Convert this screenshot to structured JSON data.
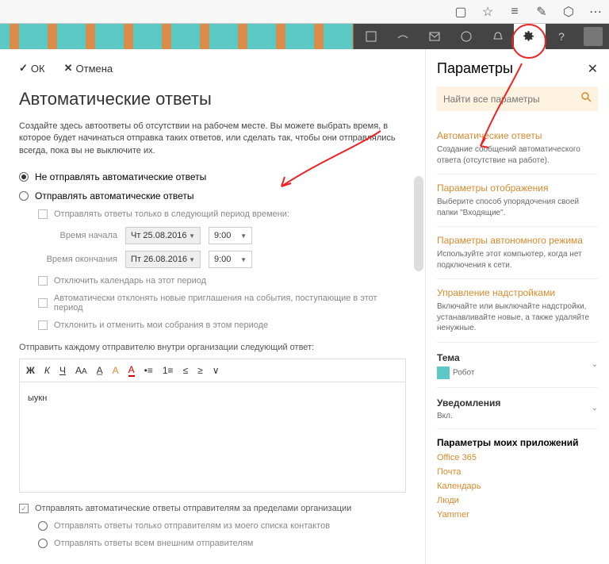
{
  "browser": {
    "icons": [
      "book",
      "star",
      "lines",
      "pen",
      "share",
      "more"
    ]
  },
  "actions": {
    "ok": "ОК",
    "cancel": "Отмена"
  },
  "main": {
    "title": "Автоматические ответы",
    "description": "Создайте здесь автоответы об отсутствии на рабочем месте. Вы можете выбрать время, в которое будет начинаться отправка таких ответов, или сделать так, чтобы они отправлялись всегда, пока вы не выключите их.",
    "radio_off": "Не отправлять автоматические ответы",
    "radio_on": "Отправлять автоматические ответы",
    "check_period": "Отправлять ответы только в следующий период времени:",
    "start_label": "Время начала",
    "start_date": "Чт 25.08.2016",
    "start_time": "9:00",
    "end_label": "Время окончания",
    "end_date": "Пт 26.08.2016",
    "end_time": "9:00",
    "check_cal": "Отключить календарь на этот период",
    "check_decline": "Автоматически отклонять новые приглашения на события, поступающие в этот период",
    "check_cancel": "Отклонить и отменить мои собрания в этом периоде",
    "reply_label": "Отправить каждому отправителю внутри организации следующий ответ:",
    "editor_text": "ыукн",
    "check_external": "Отправлять автоматические ответы отправителям за пределами организации",
    "radio_contacts": "Отправлять ответы только отправителям из моего списка контактов",
    "radio_allext": "Отправлять ответы всем внешним отправителям"
  },
  "panel": {
    "title": "Параметры",
    "search_placeholder": "Найти все параметры",
    "s1_title": "Автоматические ответы",
    "s1_desc": "Создание сообщений автоматического ответа (отсутствие на работе).",
    "s2_title": "Параметры отображения",
    "s2_desc": "Выберите способ упорядочения своей папки \"Входящие\".",
    "s3_title": "Параметры автономного режима",
    "s3_desc": "Используйте этот компьютер, когда нет подключения к сети.",
    "s4_title": "Управление надстройками",
    "s4_desc": "Включайте или выключайте надстройки, устанавливайте новые, а также удаляйте ненужные.",
    "theme_label": "Тема",
    "theme_value": "Робот",
    "notif_label": "Уведомления",
    "notif_value": "Вкл.",
    "myapps_title": "Параметры моих приложений",
    "apps": {
      "a1": "Office 365",
      "a2": "Почта",
      "a3": "Календарь",
      "a4": "Люди",
      "a5": "Yammer"
    }
  }
}
